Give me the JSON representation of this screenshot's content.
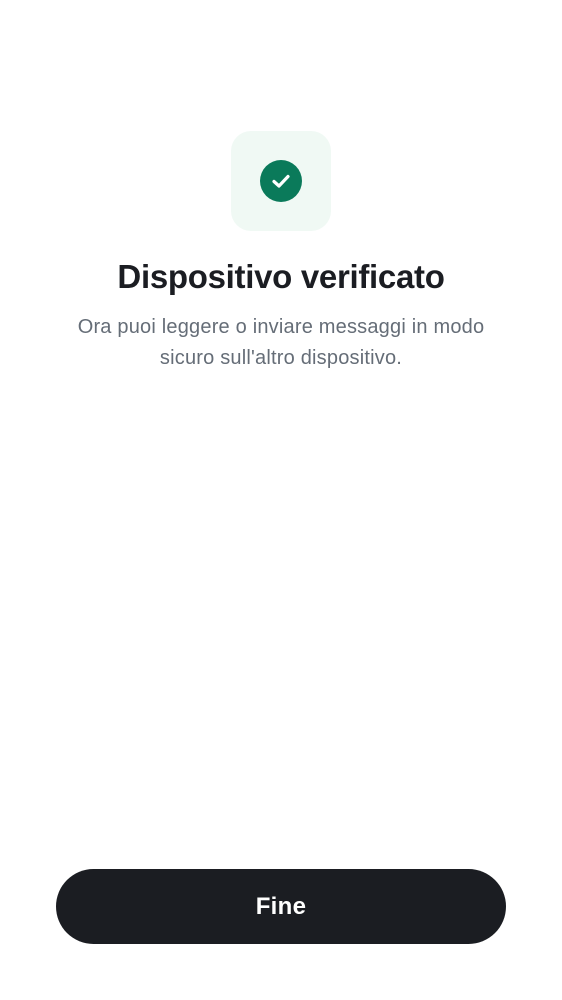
{
  "verification": {
    "icon": "check-circle-icon",
    "accent_color": "#0a7a5a",
    "tile_color": "#f0f9f4",
    "title": "Dispositivo verificato",
    "description": "Ora puoi leggere o inviare messaggi in modo sicuro sull'altro dispositivo."
  },
  "actions": {
    "done_label": "Fine",
    "done_color": "#1b1d22"
  }
}
